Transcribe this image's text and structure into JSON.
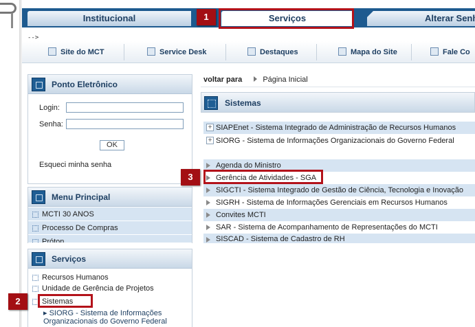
{
  "tabs": [
    {
      "label": "Institucional"
    },
    {
      "label": "Serviços",
      "active": true
    },
    {
      "label": "Alterar Senha"
    }
  ],
  "arrow_text": "-->",
  "topnav": [
    {
      "label": "Site do MCT",
      "icon": "home-icon"
    },
    {
      "label": "Service Desk",
      "icon": "tools-icon"
    },
    {
      "label": "Destaques",
      "icon": "star-icon"
    },
    {
      "label": "Mapa do Site",
      "icon": "sitemap-icon"
    },
    {
      "label": "Fale Co",
      "icon": "contact-icon"
    }
  ],
  "ponto": {
    "title": "Ponto Eletrônico",
    "login_label": "Login:",
    "senha_label": "Senha:",
    "ok_label": "OK",
    "forgot": "Esqueci minha senha"
  },
  "menu_principal": {
    "title": "Menu Principal",
    "items": [
      "MCTI 30 ANOS",
      "Processo De Compras",
      "Próton"
    ]
  },
  "servicos": {
    "title": "Serviços",
    "items": [
      "Recursos Humanos",
      "Unidade de Gerência de Projetos",
      "Sistemas"
    ],
    "sub_items": [
      "SIORG - Sistema de Informações",
      "Organizacionais do Governo Federal"
    ]
  },
  "breadcrumb": {
    "prefix": "voltar para",
    "link": "Página Inicial"
  },
  "sistemas": {
    "title": "Sistemas",
    "expandable": [
      "SIAPEnet - Sistema Integrado de Administração de Recursos Humanos",
      "SIORG - Sistema de Informações Organizacionais do Governo Federal"
    ],
    "list": [
      "Agenda do Ministro",
      "Gerência de Atividades - SGA",
      "SIGCTI - Sistema Integrado de Gestão de Ciência, Tecnologia e Inovação",
      "SIGRH - Sistema de Informações Gerenciais em Recursos Humanos",
      "Convites MCTI",
      "SAR - Sistema de Acompanhamento de Representações do MCTI",
      "SISCAD - Sistema de Cadastro de RH"
    ]
  },
  "annotations": [
    "1",
    "2",
    "3"
  ],
  "colors": {
    "accent_red": "#a30f14",
    "tab_bar": "#1d5a8f",
    "row_alt": "#d6e4f2"
  }
}
